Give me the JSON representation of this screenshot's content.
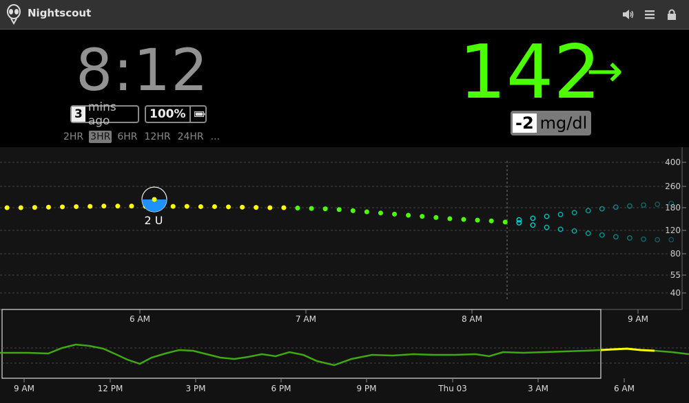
{
  "app": {
    "title": "Nightscout"
  },
  "toolbar": {
    "icons": [
      "volume-icon",
      "menu-icon",
      "lock-icon"
    ]
  },
  "status": {
    "time": "8:12",
    "mins_ago_value": "3",
    "mins_ago_label": "mins ago",
    "battery": "100%",
    "ranges": [
      "2HR",
      "3HR",
      "6HR",
      "12HR",
      "24HR",
      "..."
    ],
    "active_range": "3HR"
  },
  "reading": {
    "value": "142",
    "arrow": "→",
    "delta": "-2",
    "units": "mg/dl"
  },
  "colors": {
    "in_range": "#4cff00",
    "high": "#ffff00",
    "forecast": "#00d4d4",
    "insulin": "#1e90ff"
  },
  "chart_data": {
    "type": "scatter",
    "y_ticks": [
      "400",
      "260",
      "180",
      "120",
      "80",
      "55",
      "40"
    ],
    "x_ticks_main": [
      "6 AM",
      "7 AM",
      "8 AM",
      "9 AM"
    ],
    "x_ticks_history": [
      "9 AM",
      "12 PM",
      "3 PM",
      "6 PM",
      "9 PM",
      "Thu 03",
      "3 AM",
      "6 AM"
    ],
    "treatment": {
      "label": "2 U",
      "time": "5:53"
    },
    "glucose": {
      "times": [
        "5:12",
        "5:17",
        "5:22",
        "5:27",
        "5:32",
        "5:37",
        "5:42",
        "5:47",
        "5:52",
        "5:57",
        "6:02",
        "6:07",
        "6:12",
        "6:17",
        "6:22",
        "6:27",
        "6:32",
        "6:37",
        "6:42",
        "6:47",
        "6:52",
        "6:57",
        "7:02",
        "7:07",
        "7:12",
        "7:17",
        "7:22",
        "7:27",
        "7:32",
        "7:37",
        "7:42",
        "7:47",
        "7:52",
        "7:57",
        "8:02",
        "8:07",
        "8:12"
      ],
      "values": [
        180,
        180,
        181,
        182,
        183,
        184,
        185,
        186,
        186,
        186,
        185,
        185,
        185,
        185,
        184,
        184,
        183,
        182,
        181,
        180,
        180,
        179,
        178,
        177,
        175,
        172,
        169,
        166,
        163,
        160,
        157,
        154,
        151,
        149,
        147,
        145,
        142
      ]
    },
    "forecast_high": {
      "times": [
        "8:17",
        "8:22",
        "8:27",
        "8:32",
        "8:37",
        "8:42",
        "8:47",
        "8:52",
        "8:57",
        "9:02",
        "9:07",
        "9:12"
      ],
      "values": [
        148,
        152,
        157,
        162,
        167,
        172,
        177,
        182,
        186,
        190,
        193,
        196
      ]
    },
    "forecast_low": {
      "times": [
        "8:17",
        "8:22",
        "8:27",
        "8:32",
        "8:37",
        "8:42",
        "8:47",
        "8:52",
        "8:57",
        "9:02",
        "9:07",
        "9:12"
      ],
      "values": [
        140,
        134,
        128,
        123,
        119,
        115,
        112,
        109,
        107,
        105,
        104,
        104
      ]
    }
  }
}
